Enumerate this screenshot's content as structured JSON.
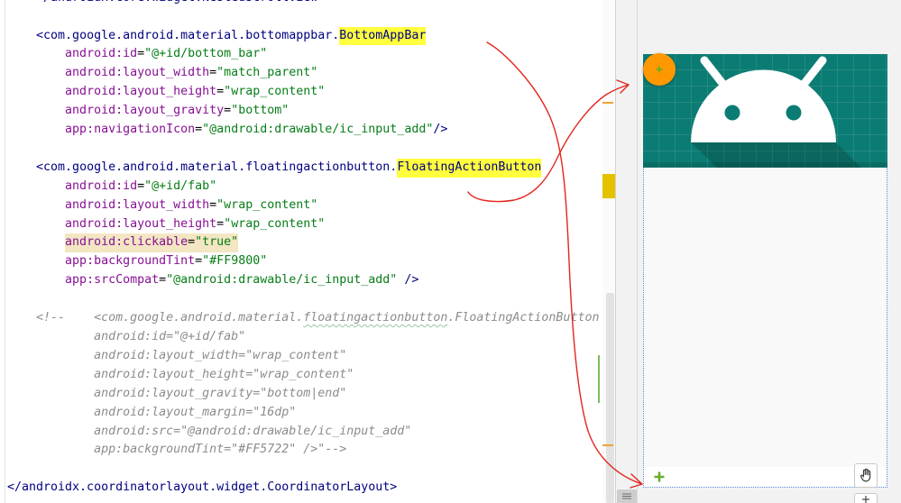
{
  "colors": {
    "tag": "#000080",
    "attribute": "#871094",
    "value": "#067d17",
    "comment": "#8c8c8c",
    "search_match": "#ffff3d",
    "usage_highlight": "#f3e6c3",
    "annotation": "#e3261e",
    "fab": "#FF9800",
    "icon_green": "#6aad2b",
    "image_bg": "#0b7c73"
  },
  "editor": {
    "lines": [
      {
        "tokens": [
          {
            "t": "ws",
            "v": "    "
          },
          {
            "t": "tag",
            "v": "</androidx.core.widget.NestedScrollView>"
          }
        ]
      },
      {
        "tokens": []
      },
      {
        "tokens": [
          {
            "t": "ws",
            "v": "    "
          },
          {
            "t": "tag",
            "v": "<com.google.android.material.bottomappbar."
          },
          {
            "t": "tag",
            "v": "BottomAppBar",
            "hl": "search_match"
          }
        ]
      },
      {
        "tokens": [
          {
            "t": "ws",
            "v": "        "
          },
          {
            "t": "attr",
            "v": "android:id"
          },
          {
            "t": "eq",
            "v": "="
          },
          {
            "t": "val",
            "v": "\"@+id/bottom_bar\""
          }
        ]
      },
      {
        "tokens": [
          {
            "t": "ws",
            "v": "        "
          },
          {
            "t": "attr",
            "v": "android:layout_width"
          },
          {
            "t": "eq",
            "v": "="
          },
          {
            "t": "val",
            "v": "\"match_parent\""
          }
        ]
      },
      {
        "tokens": [
          {
            "t": "ws",
            "v": "        "
          },
          {
            "t": "attr",
            "v": "android:layout_height"
          },
          {
            "t": "eq",
            "v": "="
          },
          {
            "t": "val",
            "v": "\"wrap_content\""
          }
        ]
      },
      {
        "tokens": [
          {
            "t": "ws",
            "v": "        "
          },
          {
            "t": "attr",
            "v": "android:layout_gravity"
          },
          {
            "t": "eq",
            "v": "="
          },
          {
            "t": "val",
            "v": "\"bottom\""
          }
        ]
      },
      {
        "tokens": [
          {
            "t": "ws",
            "v": "        "
          },
          {
            "t": "attr",
            "v": "app:navigationIcon"
          },
          {
            "t": "eq",
            "v": "="
          },
          {
            "t": "val",
            "v": "\"@android:drawable/ic_input_add\""
          },
          {
            "t": "tag",
            "v": "/>"
          }
        ]
      },
      {
        "tokens": []
      },
      {
        "tokens": [
          {
            "t": "ws",
            "v": "    "
          },
          {
            "t": "tag",
            "v": "<com.google.android.material.floatingactionbutton."
          },
          {
            "t": "tag",
            "v": "FloatingActionButton",
            "hl": "search_match"
          }
        ]
      },
      {
        "tokens": [
          {
            "t": "ws",
            "v": "        "
          },
          {
            "t": "attr",
            "v": "android:id"
          },
          {
            "t": "eq",
            "v": "="
          },
          {
            "t": "val",
            "v": "\"@+id/fab\""
          }
        ]
      },
      {
        "tokens": [
          {
            "t": "ws",
            "v": "        "
          },
          {
            "t": "attr",
            "v": "android:layout_width"
          },
          {
            "t": "eq",
            "v": "="
          },
          {
            "t": "val",
            "v": "\"wrap_content\""
          }
        ]
      },
      {
        "tokens": [
          {
            "t": "ws",
            "v": "        "
          },
          {
            "t": "attr",
            "v": "android:layout_height"
          },
          {
            "t": "eq",
            "v": "="
          },
          {
            "t": "val",
            "v": "\"wrap_content\""
          }
        ]
      },
      {
        "tokens": [
          {
            "t": "ws",
            "v": "        "
          },
          {
            "t": "attr",
            "v": "android:clickable",
            "hl": "usage_highlight"
          },
          {
            "t": "eq",
            "v": "=",
            "hl": "usage_highlight"
          },
          {
            "t": "val",
            "v": "\"true\"",
            "hl": "usage_highlight"
          }
        ]
      },
      {
        "tokens": [
          {
            "t": "ws",
            "v": "        "
          },
          {
            "t": "attr",
            "v": "app:backgroundTint"
          },
          {
            "t": "eq",
            "v": "="
          },
          {
            "t": "val",
            "v": "\"#FF9800\""
          }
        ]
      },
      {
        "tokens": [
          {
            "t": "ws",
            "v": "        "
          },
          {
            "t": "attr",
            "v": "app:srcCompat"
          },
          {
            "t": "eq",
            "v": "="
          },
          {
            "t": "val",
            "v": "\"@android:drawable/ic_input_add\""
          },
          {
            "t": "tag",
            "v": " />"
          }
        ]
      },
      {
        "tokens": []
      },
      {
        "tokens": [
          {
            "t": "ws",
            "v": "    "
          },
          {
            "t": "cmt",
            "v": "<!--    <com.google.android.material."
          },
          {
            "t": "cmt",
            "v": "floatingactionbutton",
            "typo": true
          },
          {
            "t": "cmt",
            "v": ".FloatingActionButton"
          }
        ]
      },
      {
        "tokens": [
          {
            "t": "ws",
            "v": "            "
          },
          {
            "t": "cmt",
            "v": "android:id=\"@+id/fab\""
          }
        ]
      },
      {
        "tokens": [
          {
            "t": "ws",
            "v": "            "
          },
          {
            "t": "cmt",
            "v": "android:layout_width=\"wrap_content\""
          }
        ]
      },
      {
        "tokens": [
          {
            "t": "ws",
            "v": "            "
          },
          {
            "t": "cmt",
            "v": "android:layout_height=\"wrap_content\""
          }
        ]
      },
      {
        "tokens": [
          {
            "t": "ws",
            "v": "            "
          },
          {
            "t": "cmt",
            "v": "android:layout_gravity=\"bottom|end\""
          }
        ]
      },
      {
        "tokens": [
          {
            "t": "ws",
            "v": "            "
          },
          {
            "t": "cmt",
            "v": "android:layout_margin=\"16dp\""
          }
        ]
      },
      {
        "tokens": [
          {
            "t": "ws",
            "v": "            "
          },
          {
            "t": "cmt",
            "v": "android:src=\"@android:drawable/ic_input_add\""
          }
        ]
      },
      {
        "tokens": [
          {
            "t": "ws",
            "v": "            "
          },
          {
            "t": "cmt",
            "v": "app:backgroundTint=\"#FF5722\" />\"-->"
          }
        ]
      },
      {
        "tokens": []
      },
      {
        "tokens": [
          {
            "t": "tag",
            "v": "</androidx.coordinatorlayout.widget.CoordinatorLayout>"
          }
        ]
      }
    ]
  },
  "preview": {
    "image": {
      "icon": "android-robot-icon"
    },
    "fab": {
      "icon": "plus-icon"
    },
    "bottom_app_bar": {
      "navigation_icon": "plus-icon"
    },
    "canvas_tools": [
      {
        "icon": "hand-icon"
      },
      {
        "icon": "zoom-in-icon"
      }
    ]
  }
}
